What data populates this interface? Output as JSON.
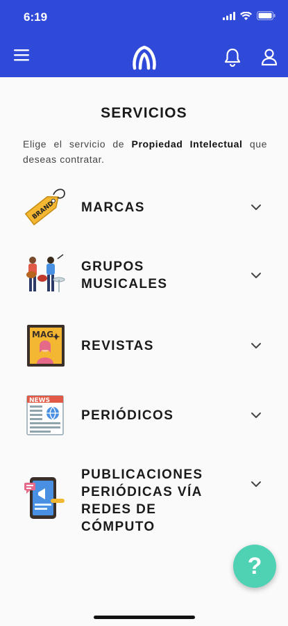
{
  "status_bar": {
    "time": "6:19"
  },
  "header": {
    "menu_icon": "hamburger-menu-icon",
    "logo_icon": "arch-logo-icon",
    "notifications_icon": "bell-icon",
    "profile_icon": "user-icon",
    "background_color": "#2f49d9"
  },
  "main": {
    "title": "SERVICIOS",
    "intro_before": "Elige el servicio de ",
    "intro_bold": "Propiedad Intelectual",
    "intro_after": " que deseas contratar."
  },
  "services": [
    {
      "label": "MARCAS",
      "icon": "brand-tag-icon"
    },
    {
      "label": "GRUPOS MUSICALES",
      "icon": "music-band-icon"
    },
    {
      "label": "REVISTAS",
      "icon": "magazine-icon"
    },
    {
      "label": "PERIÓDICOS",
      "icon": "newspaper-icon"
    },
    {
      "label": "PUBLICACIONES PERIÓDICAS VÍA REDES DE CÓMPUTO",
      "icon": "mobile-publication-icon"
    }
  ],
  "help_button": {
    "label": "?",
    "color": "#4fd1b4"
  }
}
